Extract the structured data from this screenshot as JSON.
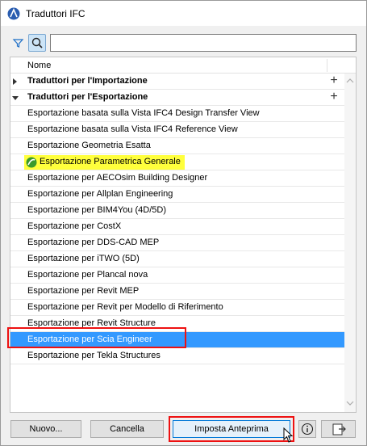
{
  "window": {
    "title": "Traduttori IFC"
  },
  "search": {
    "value": "",
    "placeholder": ""
  },
  "list": {
    "header": "Nome",
    "groups": [
      {
        "label": "Traduttori per l'Importazione",
        "expanded": false
      },
      {
        "label": "Traduttori per l'Esportazione",
        "expanded": true
      }
    ],
    "items": [
      "Esportazione basata sulla Vista IFC4 Design Transfer View",
      "Esportazione basata sulla Vista IFC4 Reference View",
      "Esportazione Geometria Esatta",
      "Esportazione Parametrica Generale",
      "Esportazione per AECOsim Building Designer",
      "Esportazione per Allplan Engineering",
      "Esportazione per BIM4You (4D/5D)",
      "Esportazione per CostX",
      "Esportazione per DDS-CAD MEP",
      "Esportazione per iTWO (5D)",
      "Esportazione per Plancal nova",
      "Esportazione per Revit MEP",
      "Esportazione per Revit per Modello di Riferimento",
      "Esportazione per Revit Structure",
      "Esportazione per Scia Engineer",
      "Esportazione per Tekla Structures"
    ],
    "selected_item": "Esportazione per Scia Engineer",
    "highlighted_item": "Esportazione Parametrica Generale"
  },
  "buttons": {
    "new": "Nuovo...",
    "delete": "Cancella",
    "set_preview": "Imposta Anteprima"
  },
  "colors": {
    "selection": "#3399ff",
    "highlight": "#ffff3c",
    "annotation_red": "#e11111",
    "accent": "#0078d7"
  },
  "icons": {
    "app": "archicad-icon",
    "filter": "filter-icon",
    "search": "search-icon",
    "info": "info-icon",
    "export": "export-icon",
    "default_translator": "gear-icon"
  }
}
